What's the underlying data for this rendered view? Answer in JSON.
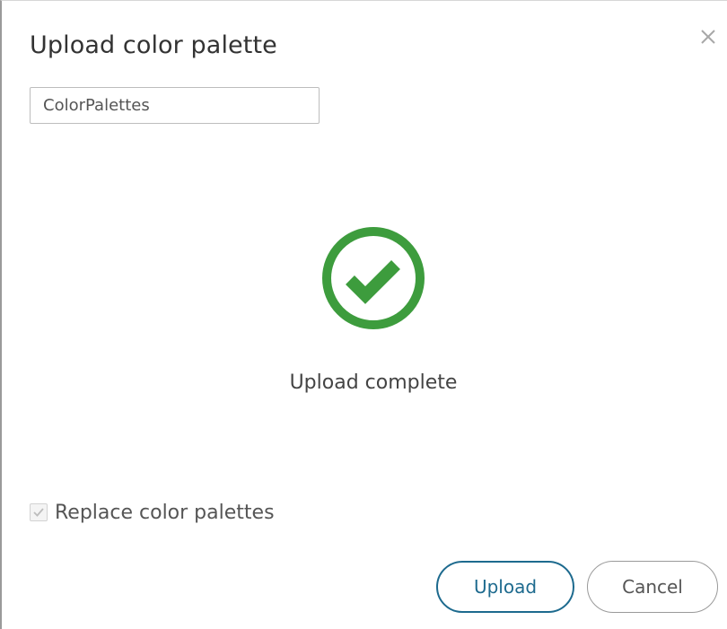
{
  "dialog": {
    "title": "Upload color palette",
    "close_icon": "close-icon"
  },
  "form": {
    "file_name_value": "ColorPalettes"
  },
  "status": {
    "icon": "check-circle-icon",
    "text": "Upload complete",
    "color": "#3d9c3d"
  },
  "options": {
    "replace_label": "Replace color palettes",
    "replace_checked": true,
    "replace_disabled": true
  },
  "buttons": {
    "upload_label": "Upload",
    "cancel_label": "Cancel"
  },
  "colors": {
    "primary": "#1d6a8e",
    "success": "#3d9c3d"
  }
}
